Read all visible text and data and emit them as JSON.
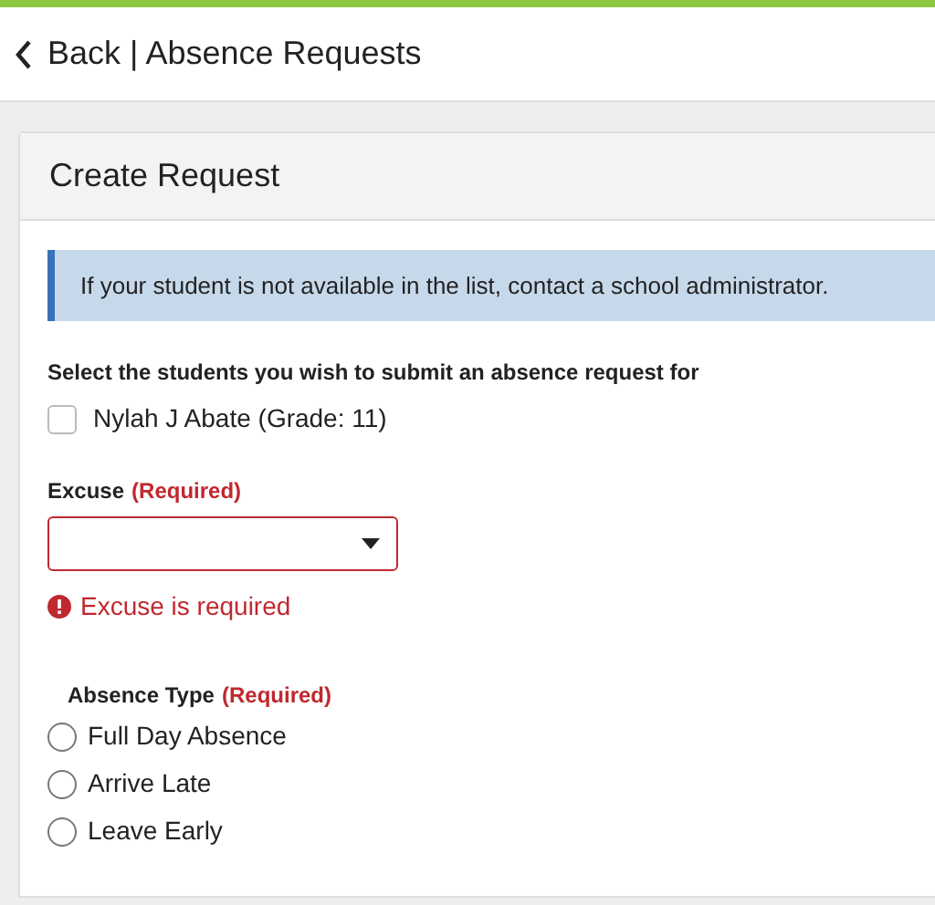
{
  "header": {
    "title": "Back | Absence Requests"
  },
  "card": {
    "title": "Create Request",
    "notice": "If your student is not available in the list, contact a school administrator.",
    "students_label": "Select the students you wish to submit an absence request for",
    "students": [
      {
        "label": "Nylah J Abate (Grade: 11)",
        "checked": false
      }
    ],
    "excuse": {
      "label": "Excuse",
      "required": "(Required)",
      "invalid": true,
      "error": "Excuse is required"
    },
    "absence_type": {
      "label": "Absence Type",
      "required": "(Required)",
      "options": [
        {
          "label": "Full Day Absence",
          "selected": false
        },
        {
          "label": "Arrive Late",
          "selected": false
        },
        {
          "label": "Leave Early",
          "selected": false
        }
      ]
    }
  }
}
